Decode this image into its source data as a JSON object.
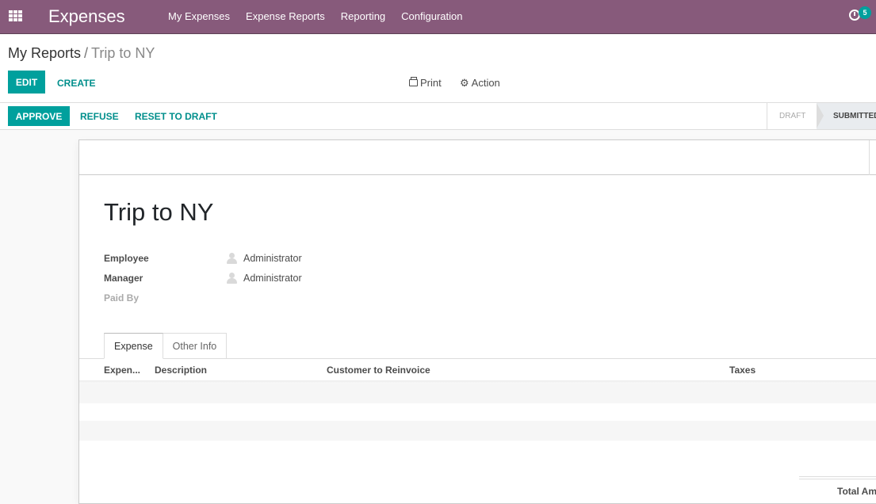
{
  "navbar": {
    "app_title": "Expenses",
    "menu": [
      "My Expenses",
      "Expense Reports",
      "Reporting",
      "Configuration"
    ],
    "activity_count": "5",
    "colors": {
      "brand": "#875a7b",
      "accent": "#00a09d"
    }
  },
  "breadcrumb": {
    "parent": "My Reports",
    "separator": "/",
    "current": "Trip to NY"
  },
  "control": {
    "edit": "Edit",
    "create": "Create",
    "print": "Print",
    "action": "Action"
  },
  "status": {
    "buttons": {
      "approve": "Approve",
      "refuse": "Refuse",
      "reset": "Reset to Draft"
    },
    "stages": [
      {
        "label": "Draft",
        "active": false
      },
      {
        "label": "Submitted",
        "active": true
      }
    ]
  },
  "form": {
    "title": "Trip to NY",
    "fields": [
      {
        "label": "Employee",
        "value": "Administrator"
      },
      {
        "label": "Manager",
        "value": "Administrator"
      },
      {
        "label": "Paid By",
        "value": ""
      }
    ],
    "tabs": [
      {
        "label": "Expense",
        "active": true
      },
      {
        "label": "Other Info",
        "active": false
      }
    ],
    "table": {
      "columns": [
        "Expen...",
        "Description",
        "Customer to Reinvoice",
        "Taxes"
      ],
      "rows": []
    },
    "total_label": "Total Am"
  }
}
